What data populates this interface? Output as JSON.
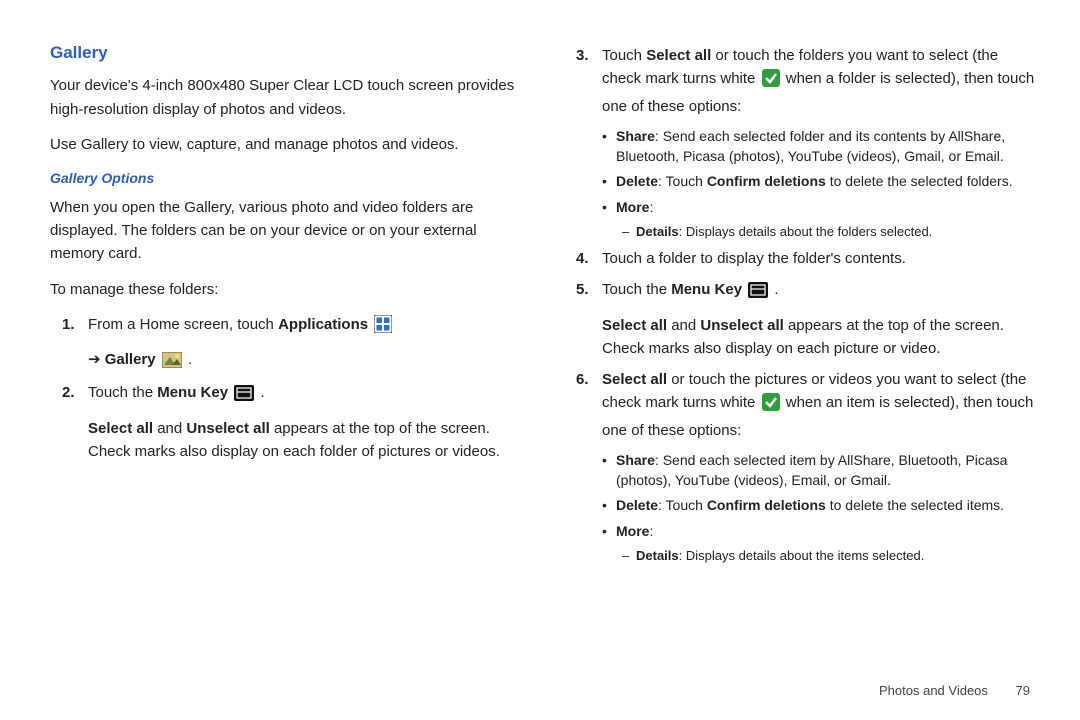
{
  "left": {
    "heading": "Gallery",
    "intro": "Your device's 4-inch 800x480 Super Clear LCD touch screen provides high-resolution display of photos and videos.",
    "use": "Use Gallery to view, capture, and manage photos and videos.",
    "subheading": "Gallery Options",
    "open_text": "When you open the Gallery, various photo and video folders are displayed. The folders can be on your device or on your external memory card.",
    "manage": "To manage these folders:",
    "step1_num": "1.",
    "step1_a": "From a Home screen, touch ",
    "step1_apps": "Applications",
    "arrow": "➔",
    "gallery_word": "Gallery",
    "period": " .",
    "step2_num": "2.",
    "step2_a": "Touch the ",
    "menukey": "Menu Key",
    "step2_end": " .",
    "step2_body1a": "Select all",
    "step2_body1b": " and ",
    "step2_body1c": "Unselect all",
    "step2_body1d": " appears at the top of the screen. Check marks also display on each folder of pictures or videos."
  },
  "right": {
    "step3_num": "3.",
    "step3_a": "Touch ",
    "step3_b": "Select all",
    "step3_c": " or touch the folders you want to select (the check mark turns white ",
    "step3_d": " when a folder is selected), then touch one of these options:",
    "share_label": "Share",
    "share_text": ": Send each selected folder and its contents by AllShare, Bluetooth, Picasa (photos), YouTube (videos), Gmail, or Email.",
    "delete_label": "Delete",
    "delete_mid": ": Touch ",
    "delete_confirm": "Confirm deletions",
    "delete_end": " to delete the selected folders.",
    "more_label": "More",
    "details_label": "Details",
    "details_text": ": Displays details about the folders selected.",
    "step4_num": "4.",
    "step4": "Touch a folder to display the folder's contents.",
    "step5_num": "5.",
    "step5_a": "Touch the ",
    "step5_end": " .",
    "step5_body1a": "Select all",
    "step5_body1b": " and ",
    "step5_body1c": "Unselect all",
    "step5_body1d": " appears at the top of the screen. Check marks also display on each picture or video.",
    "step6_num": "6.",
    "step6_a": "Select all",
    "step6_b": " or touch the pictures or videos you want to select (the check mark turns white ",
    "step6_c": " when an item is selected), then touch one of these options:",
    "share6_text": ": Send each selected item by AllShare, Bluetooth, Picasa (photos), YouTube (videos), Email, or Gmail.",
    "delete6_end": " to delete the selected items.",
    "details6_text": ": Displays details about the items selected."
  },
  "footer": {
    "section": "Photos and Videos",
    "page": "79"
  }
}
